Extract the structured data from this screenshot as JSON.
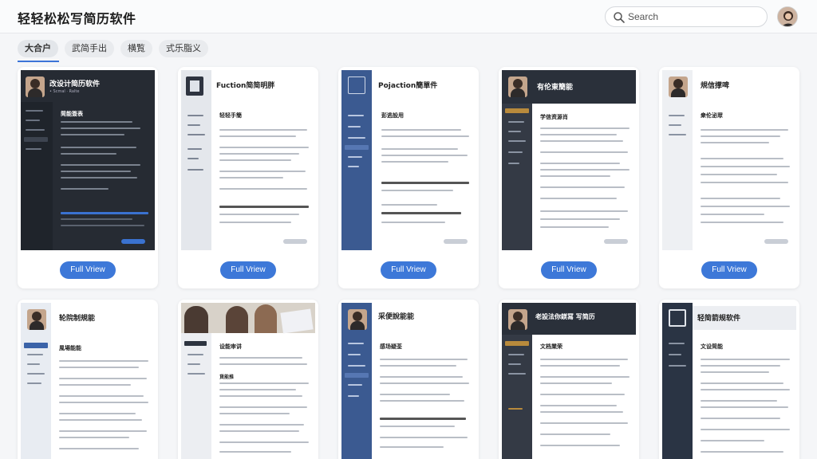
{
  "header": {
    "app_title": "轻轻松松写简历软件",
    "search_placeholder": "Search",
    "icons": {
      "search": "search-icon",
      "avatar": "user-avatar"
    }
  },
  "tabs": [
    {
      "label": "大合户",
      "active": true
    },
    {
      "label": "武简手出",
      "active": false
    },
    {
      "label": "横覧",
      "active": false
    },
    {
      "label": "式乐脂义",
      "active": false
    }
  ],
  "templates": {
    "row1": [
      {
        "name": "改设计简历软件",
        "subtitle": "• Scmal · Ralte",
        "section": "简能簽表",
        "button": "Full Vriew",
        "theme": "dark"
      },
      {
        "name": "Fuction简简明胖",
        "subtitle": "",
        "section": "轻轻手簡",
        "button": "Full Vriew",
        "theme": "gray-sidebar"
      },
      {
        "name": "Pojaction簡單件",
        "subtitle": "",
        "section": "彭逃設用",
        "button": "Full Vriew",
        "theme": "blue-sidebar"
      },
      {
        "name": "有伦東簡能",
        "subtitle": "",
        "section": "学信资源肖",
        "button": "Full Vriew",
        "theme": "dark-head"
      },
      {
        "name": "規信撑啤",
        "subtitle": "",
        "section": "衆伦泌眾",
        "button": "Full Vriew",
        "theme": "light"
      }
    ],
    "row2": [
      {
        "name": "轮院制規能",
        "section": "風場能能",
        "theme": "light-blue"
      },
      {
        "name": "设能审讲",
        "section": "貨能推",
        "theme": "photo"
      },
      {
        "name": "采便說能能",
        "section": "感场疑荃",
        "theme": "blue-sidebar"
      },
      {
        "name": "老設法你鎂冩 写简历",
        "section": "文档業荣",
        "theme": "dark-sidebar"
      },
      {
        "name": "轻简箭规软件",
        "section": "文设简能",
        "theme": "navy"
      }
    ]
  }
}
